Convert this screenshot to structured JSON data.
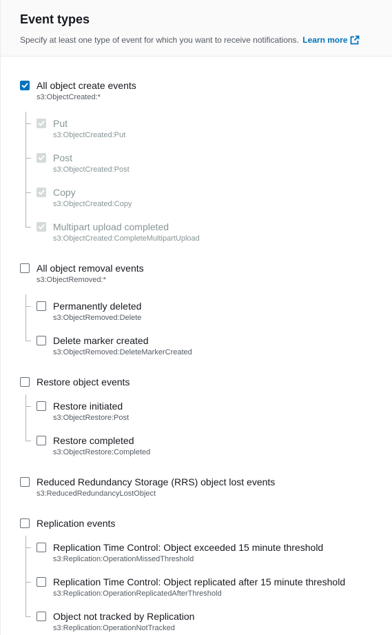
{
  "header": {
    "title": "Event types",
    "description": "Specify at least one type of event for which you want to receive notifications.",
    "learn_more": "Learn more"
  },
  "groups": [
    {
      "label": "All object create events",
      "code": "s3:ObjectCreated:*",
      "checked": true,
      "children": [
        {
          "label": "Put",
          "code": "s3:ObjectCreated:Put",
          "checked": true,
          "disabled": true
        },
        {
          "label": "Post",
          "code": "s3:ObjectCreated:Post",
          "checked": true,
          "disabled": true
        },
        {
          "label": "Copy",
          "code": "s3:ObjectCreated:Copy",
          "checked": true,
          "disabled": true
        },
        {
          "label": "Multipart upload completed",
          "code": "s3:ObjectCreated:CompleteMultipartUpload",
          "checked": true,
          "disabled": true
        }
      ]
    },
    {
      "label": "All object removal events",
      "code": "s3:ObjectRemoved:*",
      "checked": false,
      "children": [
        {
          "label": "Permanently deleted",
          "code": "s3:ObjectRemoved:Delete",
          "checked": false,
          "disabled": false
        },
        {
          "label": "Delete marker created",
          "code": "s3:ObjectRemoved:DeleteMarkerCreated",
          "checked": false,
          "disabled": false
        }
      ]
    },
    {
      "label": "Restore object events",
      "code": "",
      "checked": false,
      "children": [
        {
          "label": "Restore initiated",
          "code": "s3:ObjectRestore:Post",
          "checked": false,
          "disabled": false
        },
        {
          "label": "Restore completed",
          "code": "s3:ObjectRestore:Completed",
          "checked": false,
          "disabled": false
        }
      ]
    },
    {
      "label": "Reduced Redundancy Storage (RRS) object lost events",
      "code": "s3:ReducedRedundancyLostObject",
      "checked": false,
      "children": []
    },
    {
      "label": "Replication events",
      "code": "",
      "checked": false,
      "children": [
        {
          "label": "Replication Time Control: Object exceeded 15 minute threshold",
          "code": "s3:Replication:OperationMissedThreshold",
          "checked": false,
          "disabled": false
        },
        {
          "label": "Replication Time Control: Object replicated after 15 minute threshold",
          "code": "s3:Replication:OperationReplicatedAfterThreshold",
          "checked": false,
          "disabled": false
        },
        {
          "label": "Object not tracked by Replication",
          "code": "s3:Replication:OperationNotTracked",
          "checked": false,
          "disabled": false
        }
      ]
    }
  ],
  "colors": {
    "accent": "#0073bb",
    "disabled": "#d5dbdb",
    "text": "#16191f",
    "muted": "#545b64"
  }
}
